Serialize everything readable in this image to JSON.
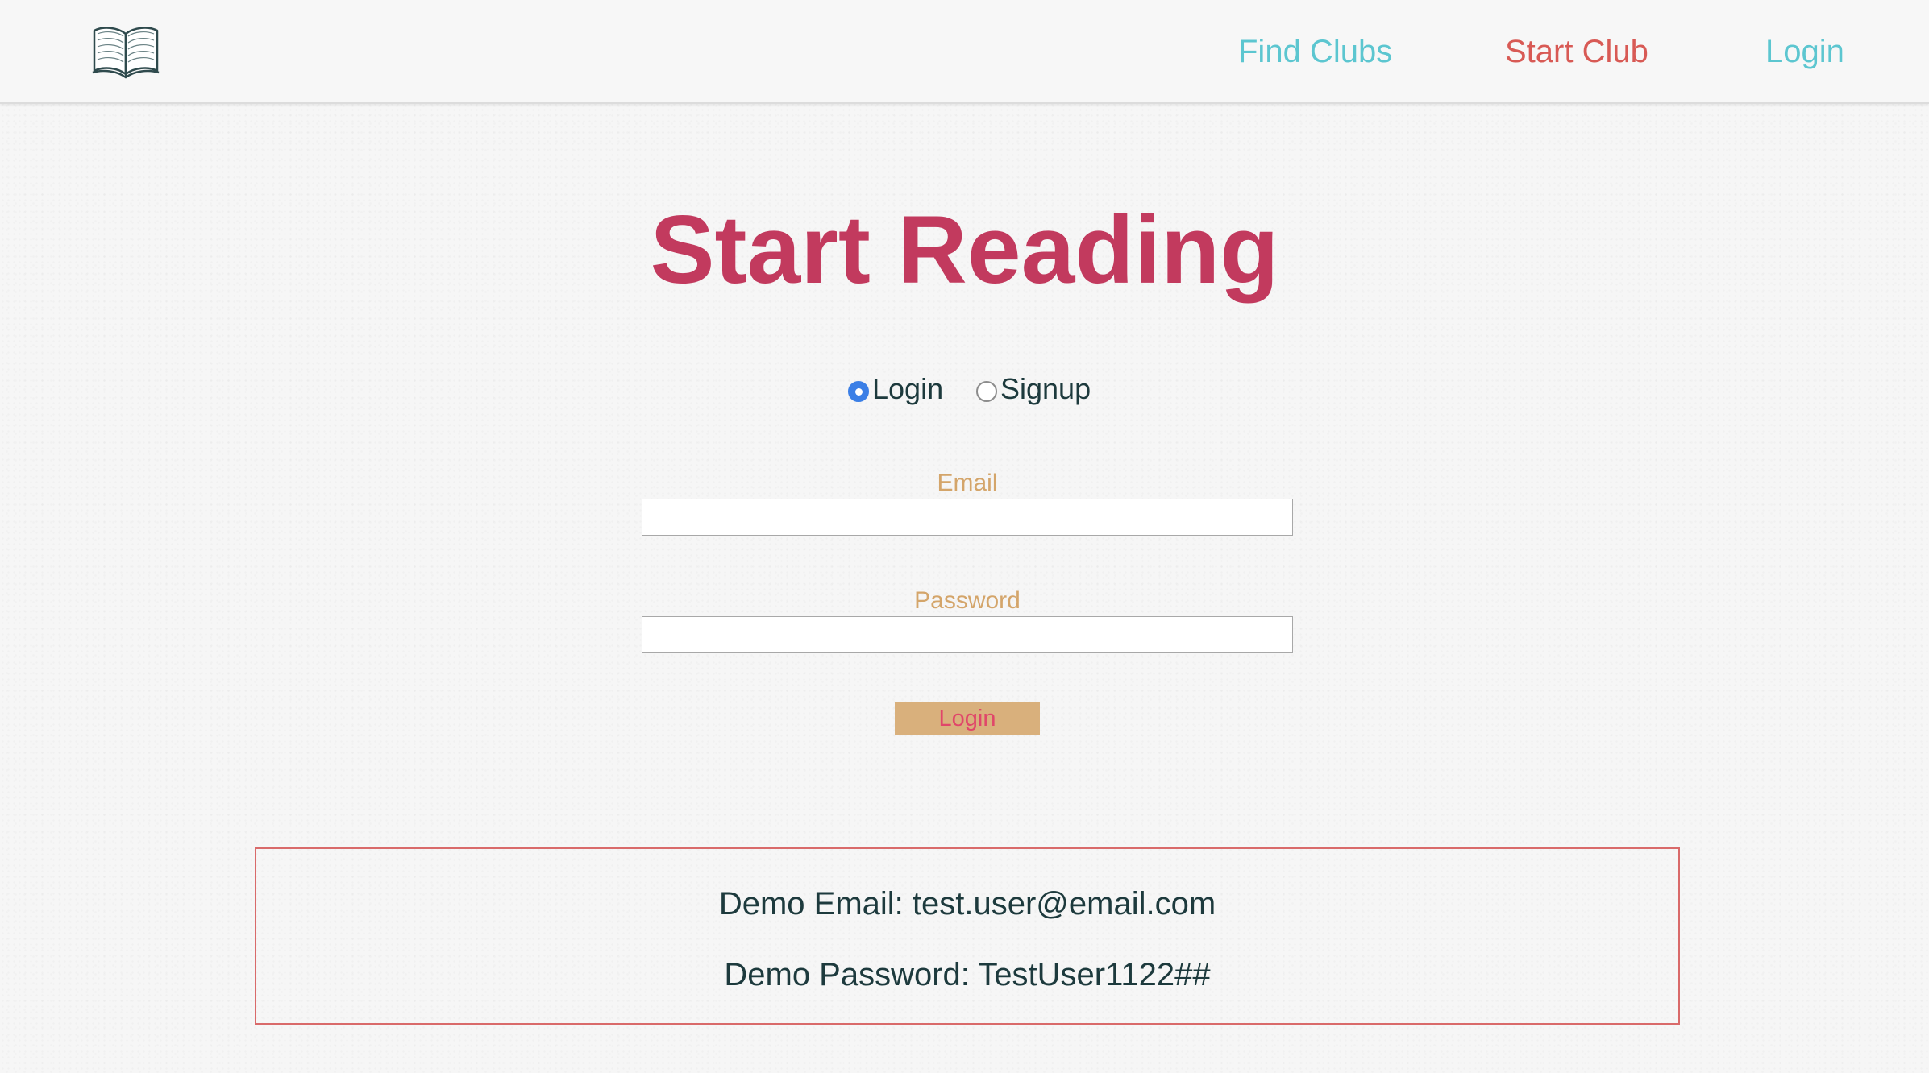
{
  "navbar": {
    "logo_icon": "open-book-icon",
    "links": [
      {
        "label": "Find Clubs",
        "color": "#5cc6d0"
      },
      {
        "label": "Start Club",
        "color": "#d85a55"
      },
      {
        "label": "Login",
        "color": "#5cc6d0"
      }
    ]
  },
  "main": {
    "title": "Start Reading",
    "mode": {
      "options": [
        "Login",
        "Signup"
      ],
      "selected": "Login"
    },
    "form": {
      "email_label": "Email",
      "email_value": "",
      "password_label": "Password",
      "password_value": "",
      "submit_label": "Login"
    },
    "demo": {
      "email_line": "Demo Email: test.user@email.com",
      "password_line": "Demo Password: TestUser1122##"
    }
  },
  "colors": {
    "title": "#c23a5e",
    "label": "#d4a56a",
    "button_bg": "#d9b07c",
    "button_text": "#e0466a",
    "demo_border": "#d96a6a",
    "radio_checked": "#3b7fe6"
  }
}
